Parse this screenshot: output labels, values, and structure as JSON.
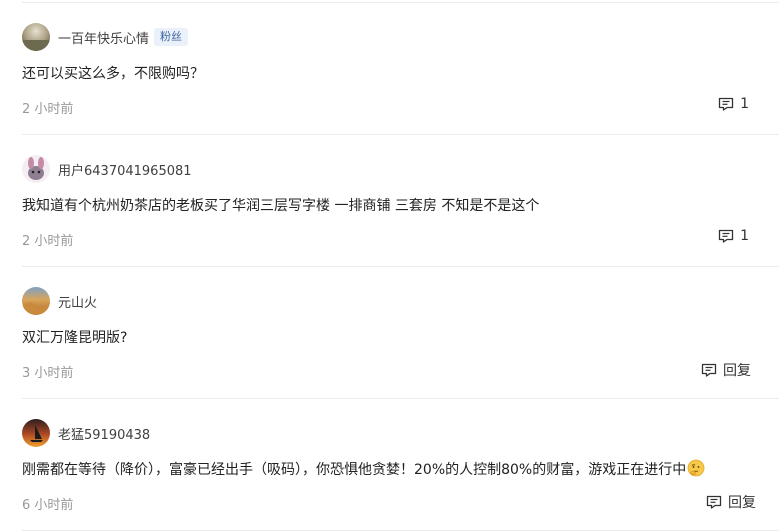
{
  "comments": [
    {
      "username": "一百年快乐心情",
      "badge": "粉丝",
      "text": "还可以买这么多，不限购吗？",
      "time": "2 小时前",
      "reply_label": "1"
    },
    {
      "username": "用户6437041965081",
      "text": "我知道有个杭州奶茶店的老板买了华润三层写字楼 一排商铺 三套房 不知是不是这个",
      "time": "2 小时前",
      "reply_label": "1"
    },
    {
      "username": "元山火",
      "text": "双汇万隆昆明版?",
      "time": "3 小时前",
      "reply_label": "回复"
    },
    {
      "username": "老猛59190438",
      "text": "刚需都在等待（降价），富豪已经出手（吸码），你恐惧他贪婪！20%的人控制80%的财富，游戏正在进行中",
      "time": "6 小时前",
      "reply_label": "回复"
    }
  ],
  "icons": {
    "reply": "comment-icon",
    "emoji": "thinking-face-emoji"
  },
  "colors": {
    "text": "#222222",
    "meta": "#999999",
    "username": "#404040",
    "badge_text": "#406599",
    "badge_bg": "#eaf1fb",
    "divider": "#ececec"
  }
}
